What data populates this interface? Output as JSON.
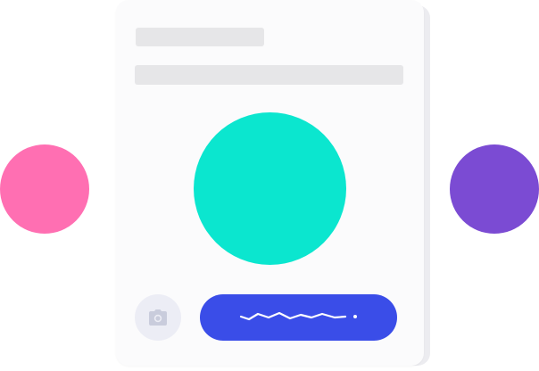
{
  "colors": {
    "photo": "#0be6cf",
    "sign_button": "#3a4de8",
    "left_dot": "#ff6fb2",
    "right_dot": "#7b4bd3",
    "camera_icon": "#c9ccdc",
    "signature_stroke": "#ffffff"
  },
  "icons": {
    "camera": "camera-icon",
    "signature": "signature-icon"
  }
}
